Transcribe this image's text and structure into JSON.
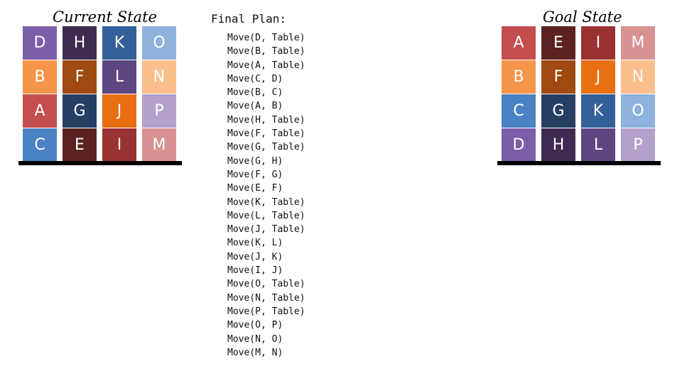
{
  "current_state": {
    "title": "Current State",
    "stacks": [
      [
        {
          "label": "D",
          "color": "#7b5ea7"
        },
        {
          "label": "B",
          "color": "#f5954a"
        },
        {
          "label": "A",
          "color": "#c44e4e"
        },
        {
          "label": "C",
          "color": "#4b82c3"
        }
      ],
      [
        {
          "label": "H",
          "color": "#3f2b52"
        },
        {
          "label": "F",
          "color": "#a04a12"
        },
        {
          "label": "G",
          "color": "#263f63"
        },
        {
          "label": "E",
          "color": "#5c2222"
        }
      ],
      [
        {
          "label": "K",
          "color": "#34609a"
        },
        {
          "label": "L",
          "color": "#5e4680"
        },
        {
          "label": "J",
          "color": "#e86e12"
        },
        {
          "label": "I",
          "color": "#9a3232"
        }
      ],
      [
        {
          "label": "O",
          "color": "#8fb2dc"
        },
        {
          "label": "N",
          "color": "#fbbf8e"
        },
        {
          "label": "P",
          "color": "#b3a1cb"
        },
        {
          "label": "M",
          "color": "#d99292"
        }
      ]
    ]
  },
  "goal_state": {
    "title": "Goal State",
    "stacks": [
      [
        {
          "label": "A",
          "color": "#c44e4e"
        },
        {
          "label": "B",
          "color": "#f5954a"
        },
        {
          "label": "C",
          "color": "#4b82c3"
        },
        {
          "label": "D",
          "color": "#7b5ea7"
        }
      ],
      [
        {
          "label": "E",
          "color": "#5c2222"
        },
        {
          "label": "F",
          "color": "#a04a12"
        },
        {
          "label": "G",
          "color": "#263f63"
        },
        {
          "label": "H",
          "color": "#3f2b52"
        }
      ],
      [
        {
          "label": "I",
          "color": "#9a3232"
        },
        {
          "label": "J",
          "color": "#e86e12"
        },
        {
          "label": "K",
          "color": "#34609a"
        },
        {
          "label": "L",
          "color": "#5e4680"
        }
      ],
      [
        {
          "label": "M",
          "color": "#d99292"
        },
        {
          "label": "N",
          "color": "#fbbf8e"
        },
        {
          "label": "O",
          "color": "#8fb2dc"
        },
        {
          "label": "P",
          "color": "#b3a1cb"
        }
      ]
    ]
  },
  "plan": {
    "title": "Final Plan:",
    "steps": [
      "Move(D, Table)",
      "Move(B, Table)",
      "Move(A, Table)",
      "Move(C, D)",
      "Move(B, C)",
      "Move(A, B)",
      "Move(H, Table)",
      "Move(F, Table)",
      "Move(G, Table)",
      "Move(G, H)",
      "Move(F, G)",
      "Move(E, F)",
      "Move(K, Table)",
      "Move(L, Table)",
      "Move(J, Table)",
      "Move(K, L)",
      "Move(J, K)",
      "Move(I, J)",
      "Move(O, Table)",
      "Move(N, Table)",
      "Move(P, Table)",
      "Move(O, P)",
      "Move(N, O)",
      "Move(M, N)"
    ]
  }
}
